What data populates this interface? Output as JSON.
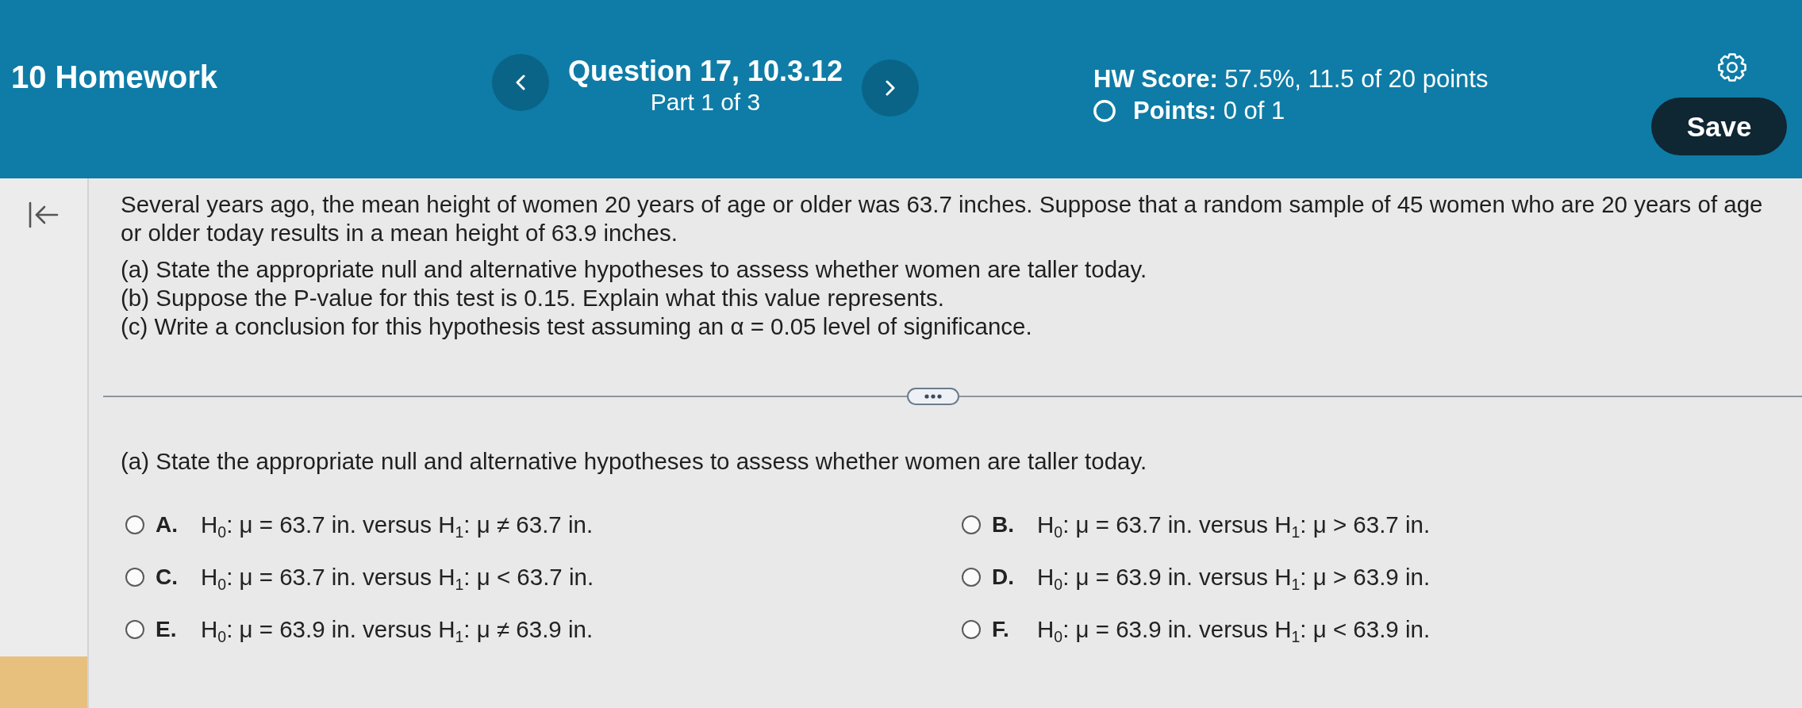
{
  "header": {
    "course_title": "10 Homework",
    "question_title": "Question 17, 10.3.12",
    "part": "Part 1 of 3",
    "hw_score": "**HW Score:** 57.5%, 11.5 of 20 points",
    "points": "**Points:** 0 of 1",
    "save_label": "Save"
  },
  "question": {
    "intro": "Several years ago, the mean height of women 20 years of age or older was 63.7 inches. Suppose that a random sample of 45 women who are 20 years of age or older today results in a mean height of 63.9 inches.",
    "parts": [
      "(a) State the appropriate null and alternative hypotheses to assess whether women are taller today.",
      "(b) Suppose the P-value for this test is 0.15. Explain what this value represents.",
      "(c) Write a conclusion for this hypothesis test assuming an α = 0.05 level of significance."
    ]
  },
  "prompt": "(a) State the appropriate null and alternative hypotheses to assess whether women are taller today.",
  "options": [
    {
      "letter": "A.",
      "text": "H$_{0}$: μ = 63.7 in. versus H$_{1}$: μ ≠ 63.7 in.",
      "selected": false
    },
    {
      "letter": "B.",
      "text": "H$_{0}$: μ = 63.7 in. versus H$_{1}$: μ > 63.7 in.",
      "selected": false
    },
    {
      "letter": "C.",
      "text": "H$_{0}$: μ = 63.7 in. versus H$_{1}$: μ < 63.7 in.",
      "selected": false
    },
    {
      "letter": "D.",
      "text": "H$_{0}$: μ = 63.9 in. versus H$_{1}$: μ > 63.9 in.",
      "selected": false
    },
    {
      "letter": "E.",
      "text": "H$_{0}$: μ = 63.9 in. versus H$_{1}$: μ ≠ 63.9 in.",
      "selected": false
    },
    {
      "letter": "F.",
      "text": "H$_{0}$: μ = 63.9 in. versus H$_{1}$: μ < 63.9 in.",
      "selected": false
    }
  ]
}
